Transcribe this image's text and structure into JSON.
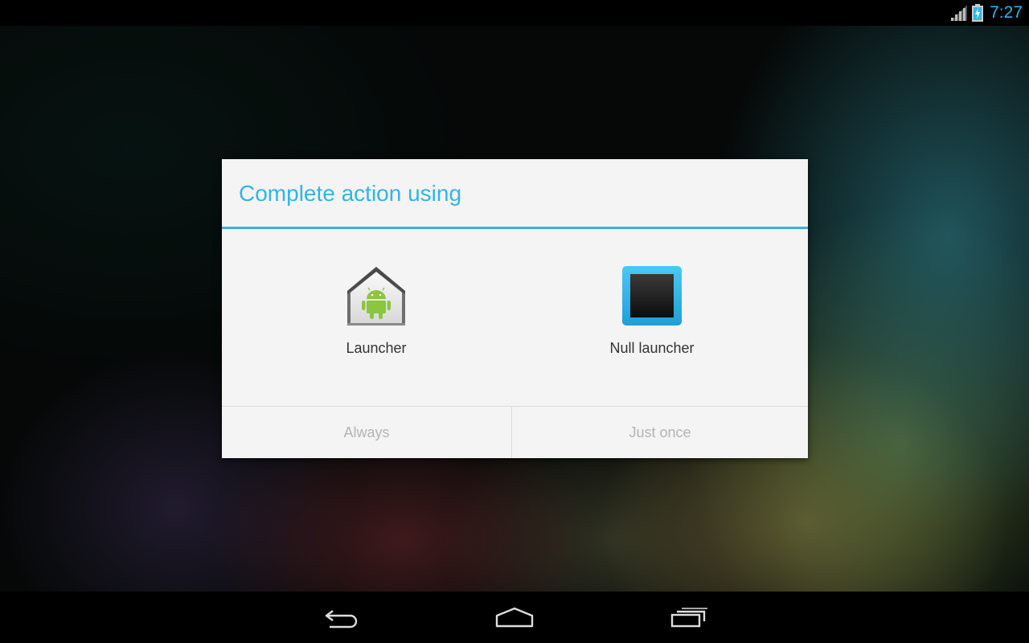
{
  "status_bar": {
    "time": "7:27",
    "signal_icon": "signal-icon",
    "battery_icon": "battery-charging-icon",
    "accent_color": "#33b5e5"
  },
  "dialog": {
    "title": "Complete action using",
    "accent_color": "#33b5e5",
    "apps": [
      {
        "label": "Launcher",
        "icon": "android-home-icon"
      },
      {
        "label": "Null launcher",
        "icon": "null-launcher-icon"
      }
    ],
    "buttons": {
      "always": "Always",
      "just_once": "Just once"
    }
  },
  "nav_bar": {
    "back_icon": "back-icon",
    "home_icon": "home-icon",
    "recents_icon": "recents-icon"
  }
}
